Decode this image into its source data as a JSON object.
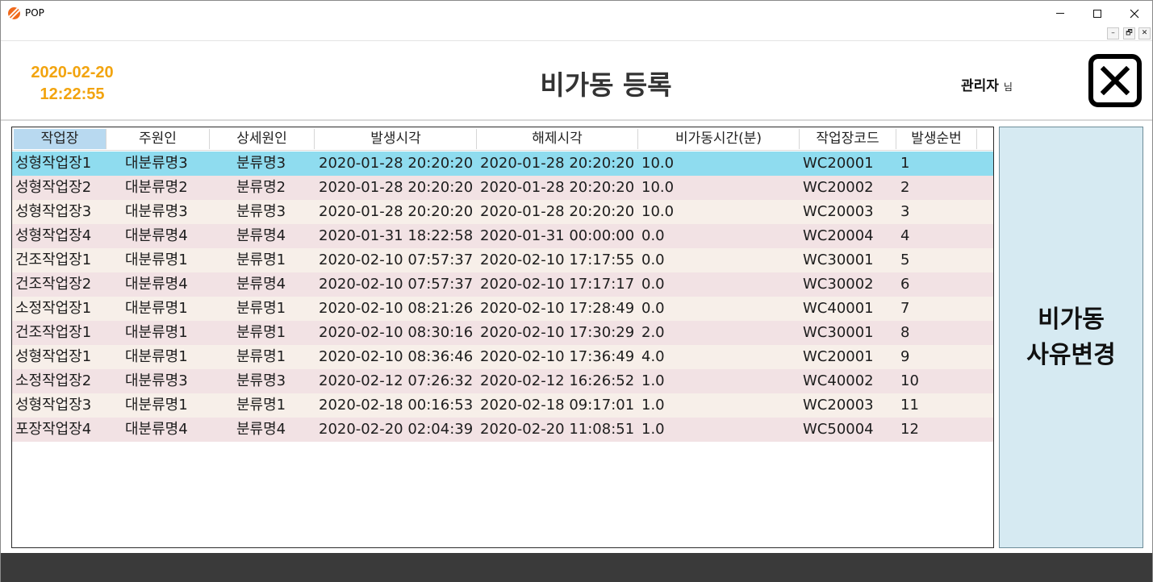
{
  "window": {
    "title": "POP",
    "controls": [
      "minimize",
      "maximize",
      "close"
    ],
    "mdi_controls": [
      "–",
      "🗗",
      "✕"
    ]
  },
  "header": {
    "date": "2020-02-20",
    "time": "12:22:55",
    "title": "비가동 등록",
    "user": "관리자",
    "user_suffix": "님",
    "date_color": "#f2a40f"
  },
  "grid": {
    "columns": [
      "작업장",
      "주원인",
      "상세원인",
      "발생시각",
      "해제시각",
      "비가동시간(분)",
      "작업장코드",
      "발생순번"
    ],
    "selected_column": 0,
    "selected_row": 0,
    "rows": [
      [
        "성형작업장1",
        "대분류명3",
        "분류명3",
        "2020-01-28 20:20:20",
        "2020-01-28 20:20:20",
        "10.0",
        "WC20001",
        "1"
      ],
      [
        "성형작업장2",
        "대분류명2",
        "분류명2",
        "2020-01-28 20:20:20",
        "2020-01-28 20:20:20",
        "10.0",
        "WC20002",
        "2"
      ],
      [
        "성형작업장3",
        "대분류명3",
        "분류명3",
        "2020-01-28 20:20:20",
        "2020-01-28 20:20:20",
        "10.0",
        "WC20003",
        "3"
      ],
      [
        "성형작업장4",
        "대분류명4",
        "분류명4",
        "2020-01-31 18:22:58",
        "2020-01-31 00:00:00",
        "0.0",
        "WC20004",
        "4"
      ],
      [
        "건조작업장1",
        "대분류명1",
        "분류명1",
        "2020-02-10 07:57:37",
        "2020-02-10 17:17:55",
        "0.0",
        "WC30001",
        "5"
      ],
      [
        "건조작업장2",
        "대분류명4",
        "분류명4",
        "2020-02-10 07:57:37",
        "2020-02-10 17:17:17",
        "0.0",
        "WC30002",
        "6"
      ],
      [
        "소정작업장1",
        "대분류명1",
        "분류명1",
        "2020-02-10 08:21:26",
        "2020-02-10 17:28:49",
        "0.0",
        "WC40001",
        "7"
      ],
      [
        "건조작업장1",
        "대분류명1",
        "분류명1",
        "2020-02-10 08:30:16",
        "2020-02-10 17:30:29",
        "2.0",
        "WC30001",
        "8"
      ],
      [
        "성형작업장1",
        "대분류명1",
        "분류명1",
        "2020-02-10 08:36:46",
        "2020-02-10 17:36:49",
        "4.0",
        "WC20001",
        "9"
      ],
      [
        "소정작업장2",
        "대분류명3",
        "분류명3",
        "2020-02-12 07:26:32",
        "2020-02-12 16:26:52",
        "1.0",
        "WC40002",
        "10"
      ],
      [
        "성형작업장3",
        "대분류명1",
        "분류명1",
        "2020-02-18 00:16:53",
        "2020-02-18 09:17:01",
        "1.0",
        "WC20003",
        "11"
      ],
      [
        "포장작업장4",
        "대분류명4",
        "분류명4",
        "2020-02-20 02:04:39",
        "2020-02-20 11:08:51",
        "1.0",
        "WC50004",
        "12"
      ]
    ],
    "row_colors": {
      "selected": "#8fdcef",
      "odd": "#f2e2e4",
      "even": "#f7efe9"
    }
  },
  "side_button": {
    "line1": "비가동",
    "line2": "사유변경"
  },
  "icons": {
    "app": "pop-logo-icon",
    "exit": "close-x-icon"
  }
}
